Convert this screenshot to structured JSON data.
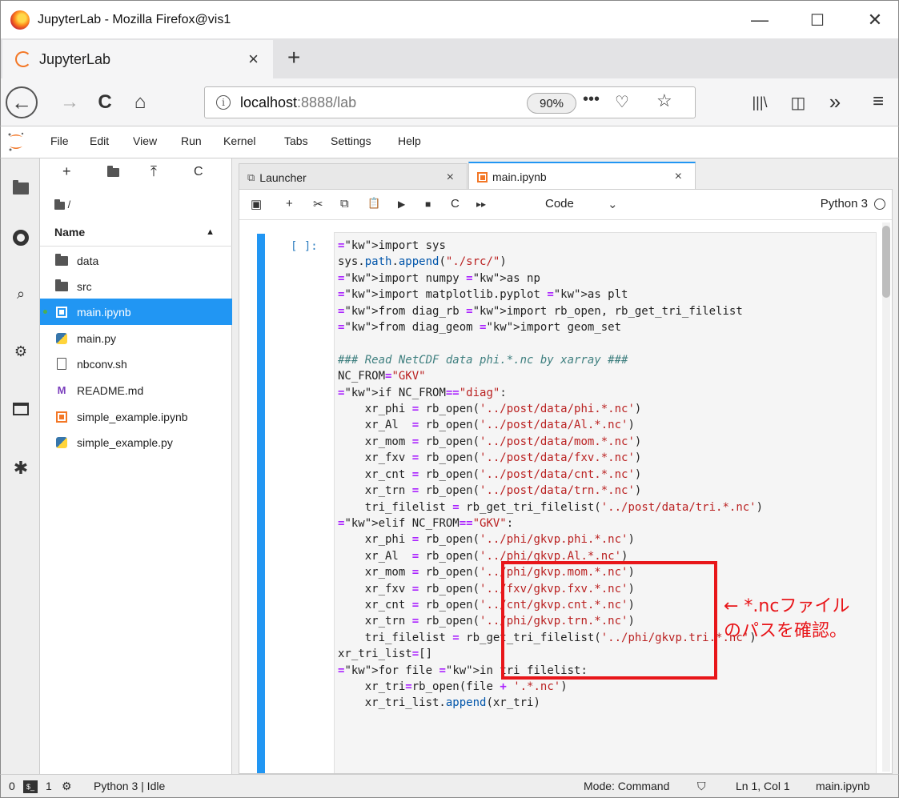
{
  "window": {
    "title": "JupyterLab - Mozilla Firefox@vis1",
    "minimize": "—",
    "maximize": "☐",
    "close": "✕"
  },
  "browser_tab": {
    "label": "JupyterLab",
    "close": "×",
    "new_tab": "+"
  },
  "navbar": {
    "back": "←",
    "forward": "→",
    "reload": "C",
    "home": "⌂",
    "url_host": "localhost",
    "url_path": ":8888/lab",
    "zoom": "90%",
    "more": "•••",
    "pocket": "♡",
    "bookmark": "☆",
    "library": "|||\\",
    "sidebar": "◫",
    "overflow": "»",
    "menu": "≡"
  },
  "menubar": {
    "items": [
      "File",
      "Edit",
      "View",
      "Run",
      "Kernel",
      "Tabs",
      "Settings",
      "Help"
    ]
  },
  "filebrowser": {
    "tools": {
      "new": "+",
      "new_folder": "▪",
      "upload": "⤒",
      "refresh": "C"
    },
    "breadcrumb": "/",
    "column": "Name",
    "sort_caret": "▲",
    "files": [
      {
        "name": "data",
        "icon": "folder-icon"
      },
      {
        "name": "src",
        "icon": "folder-icon"
      },
      {
        "name": "main.ipynb",
        "icon": "notebook-icon",
        "selected": true
      },
      {
        "name": "main.py",
        "icon": "python-icon"
      },
      {
        "name": "nbconv.sh",
        "icon": "file-icon"
      },
      {
        "name": "README.md",
        "icon": "markdown-icon"
      },
      {
        "name": "simple_example.ipynb",
        "icon": "notebook-icon"
      },
      {
        "name": "simple_example.py",
        "icon": "python-icon"
      }
    ]
  },
  "doc_tabs": [
    {
      "label": "Launcher",
      "close": "×"
    },
    {
      "label": "main.ipynb",
      "close": "×"
    }
  ],
  "notebook_toolbar": {
    "save": "▣",
    "insert": "+",
    "cut": "✂",
    "copy": "⧉",
    "paste": "📋",
    "run": "▶",
    "stop": "■",
    "restart": "C",
    "run_all": "▸▸",
    "cell_type": "Code",
    "cell_type_caret": "⌄",
    "kernel": "Python 3"
  },
  "cell": {
    "prompt": "[ ]:",
    "lines": [
      "import sys",
      "sys.path.append(\"./src/\")",
      "import numpy as np",
      "import matplotlib.pyplot as plt",
      "from diag_rb import rb_open, rb_get_tri_filelist",
      "from diag_geom import geom_set",
      "",
      "### Read NetCDF data phi.*.nc by xarray ###",
      "NC_FROM=\"GKV\"",
      "if NC_FROM==\"diag\":",
      "    xr_phi = rb_open('../post/data/phi.*.nc')",
      "    xr_Al  = rb_open('../post/data/Al.*.nc')",
      "    xr_mom = rb_open('../post/data/mom.*.nc')",
      "    xr_fxv = rb_open('../post/data/fxv.*.nc')",
      "    xr_cnt = rb_open('../post/data/cnt.*.nc')",
      "    xr_trn = rb_open('../post/data/trn.*.nc')",
      "    tri_filelist = rb_get_tri_filelist('../post/data/tri.*.nc')",
      "elif NC_FROM==\"GKV\":",
      "    xr_phi = rb_open('../phi/gkvp.phi.*.nc')",
      "    xr_Al  = rb_open('../phi/gkvp.Al.*.nc')",
      "    xr_mom = rb_open('../phi/gkvp.mom.*.nc')",
      "    xr_fxv = rb_open('../fxv/gkvp.fxv.*.nc')",
      "    xr_cnt = rb_open('../cnt/gkvp.cnt.*.nc')",
      "    xr_trn = rb_open('../phi/gkvp.trn.*.nc')",
      "    tri_filelist = rb_get_tri_filelist('../phi/gkvp.tri.*.nc')",
      "xr_tri_list=[]",
      "for file in tri_filelist:",
      "    xr_tri=rb_open(file + '.*.nc')",
      "    xr_tri_list.append(xr_tri)"
    ]
  },
  "annotation": {
    "text": "← *.ncファイル\nのパスを確認。",
    "color": "#e8161a"
  },
  "statusbar": {
    "terminals": "0",
    "term_icon": "$_",
    "kernels": "1",
    "kernel_icon": "⚙",
    "kernel_status": "Python 3 | Idle",
    "mode": "Mode: Command",
    "shield": "⛉",
    "position": "Ln 1, Col 1",
    "filename": "main.ipynb"
  },
  "colors": {
    "accent": "#2196f3",
    "jupyter_orange": "#f37726",
    "keyword": "#008000",
    "string": "#ba2121",
    "comment": "#408080"
  }
}
